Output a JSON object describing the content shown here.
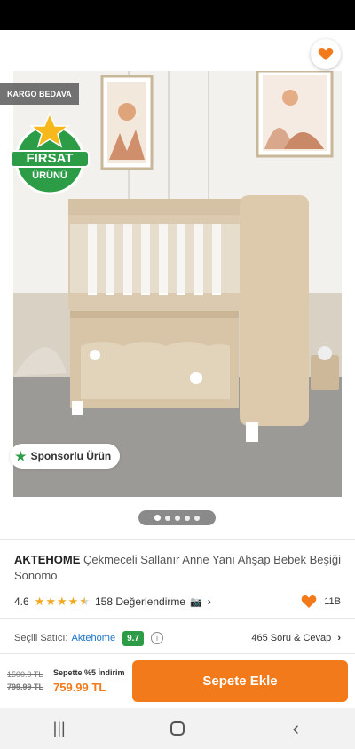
{
  "topbar": {
    "back_icon": "back-arrow-icon",
    "share_icon": "share-icon",
    "favorite_icon": "heart-icon"
  },
  "badges": {
    "kargo": "KARGO BEDAVA",
    "firsat_line1": "FIRSAT",
    "firsat_line2": "ÜRÜNÜ",
    "sponsored": "Sponsorlu Ürün"
  },
  "gallery": {
    "dot_count": 5,
    "active_index": 0
  },
  "product": {
    "brand": "AKTEHOME",
    "name": "Çekmeceli Sallanır Anne Yanı Ahşap Bebek Beşiği Sonomo",
    "rating": "4.6",
    "rating_value": 4.6,
    "reviews_label": "158 Değerlendirme",
    "likes": "11B"
  },
  "seller": {
    "label": "Seçili Satıcı:",
    "name": "Aktehome",
    "score": "9.7",
    "qa_label": "465 Soru & Cevap"
  },
  "pricing": {
    "original_price": "1500.0 TL",
    "crossed_price": "799.99 TL",
    "discount_label": "Sepette %5 İndirim",
    "final_price": "759.99 TL",
    "cart_button": "Sepete Ekle"
  },
  "colors": {
    "accent": "#f27a1a",
    "seller_score": "#2c9d46",
    "link": "#1a73c7"
  }
}
